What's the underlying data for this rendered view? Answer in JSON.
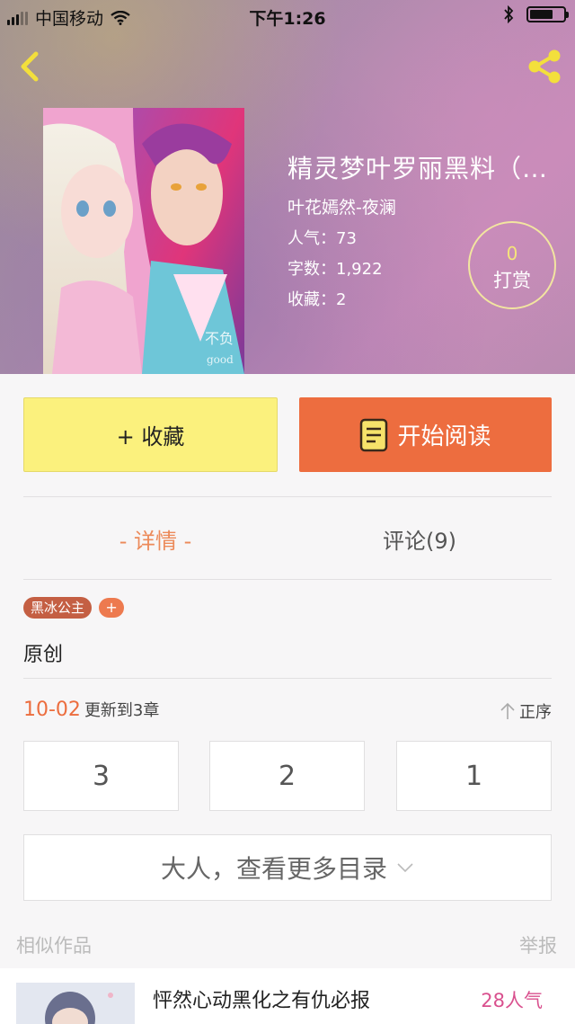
{
  "status_bar": {
    "carrier": "中国移动",
    "time": "下午1:26",
    "battery_level": 0.7
  },
  "book": {
    "title": "精灵梦叶罗丽黑料（…",
    "author": "叶花嫣然-夜澜",
    "popularity_label": "人气：",
    "popularity": "73",
    "words_label": "字数：",
    "words": "1,922",
    "favorites_label": "收藏：",
    "favorites": "2",
    "cover_watermark": "不负 good"
  },
  "tip": {
    "count": "0",
    "label": "打赏"
  },
  "actions": {
    "collect_label": "+ 收藏",
    "read_label": "开始阅读"
  },
  "tabs": {
    "details": "- 详情 -",
    "comments": "评论(9)"
  },
  "tags": {
    "items": [
      "黑冰公主"
    ],
    "add": "+"
  },
  "category": "原创",
  "update": {
    "date": "10-02",
    "text": "更新到3章",
    "sort_label": "正序"
  },
  "chapters": [
    "3",
    "2",
    "1"
  ],
  "more_catalog": "大人，查看更多目录",
  "similar": {
    "label": "相似作品",
    "report": "举报",
    "items": [
      {
        "title": "怦然心动黑化之有仇必报",
        "popularity": "28人气"
      }
    ]
  },
  "colors": {
    "accent_orange": "#ed6d3f",
    "collect_yellow": "#fbf17d",
    "tag_brown": "#c45f43",
    "popularity_pink": "#d9508e"
  }
}
